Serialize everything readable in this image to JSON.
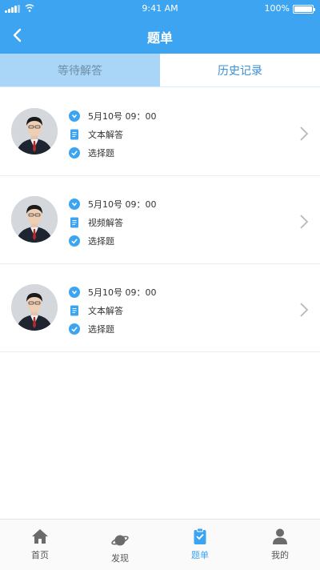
{
  "status_bar": {
    "time": "9:41 AM",
    "battery": "100%"
  },
  "header": {
    "title": "题单"
  },
  "tabs": [
    {
      "label": "等待解答",
      "active": true
    },
    {
      "label": "历史记录",
      "active": false
    }
  ],
  "items": [
    {
      "datetime": "5月10号  09：00",
      "answer_type": "文本解答",
      "question_type": "选择题"
    },
    {
      "datetime": "5月10号 09：00",
      "answer_type": "视频解答",
      "question_type": "选择题"
    },
    {
      "datetime": "5月10号 09：00",
      "answer_type": "文本解答",
      "question_type": "选择题"
    }
  ],
  "bottom_nav": [
    {
      "label": "首页",
      "icon": "home-icon",
      "active": false
    },
    {
      "label": "发现",
      "icon": "planet-icon",
      "active": false
    },
    {
      "label": "题单",
      "icon": "clipboard-icon",
      "active": true
    },
    {
      "label": "我的",
      "icon": "user-icon",
      "active": false
    }
  ],
  "colors": {
    "primary": "#3ca4f0",
    "tab_active_bg": "#a9d5f7",
    "text": "#333333"
  }
}
